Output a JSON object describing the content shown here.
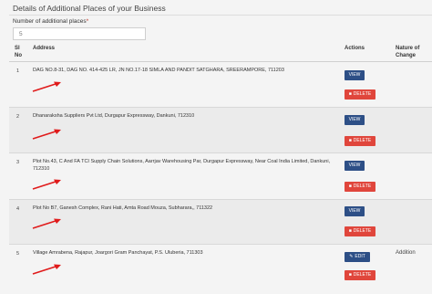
{
  "section": {
    "title": "Details of Additional Places of your Business",
    "field_label": "Number of additional places",
    "required_marker": "*",
    "field_value": "5"
  },
  "table": {
    "headers": {
      "sl_no_line1": "Sl",
      "sl_no_line2": "No",
      "address": "Address",
      "actions": "Actions",
      "nature_line1": "Nature of",
      "nature_line2": "Change"
    },
    "rows": [
      {
        "sl_no": "1",
        "address": "DAG NO.8-31, DAG NO. 414-425 LR, JN NO.17-18 SIMLA AND PANDIT SATGHARA, SREERAMPORE, 711203",
        "primary_action": "VIEW",
        "delete_action": "DELETE",
        "nature_of_change": ""
      },
      {
        "sl_no": "2",
        "address": "Dhanaraksha Suppliers Pvt Ltd, Durgapur Expressway, Dankuni, 712310",
        "primary_action": "VIEW",
        "delete_action": "DELETE",
        "nature_of_change": ""
      },
      {
        "sl_no": "3",
        "address": "Plot No.43, C And FA TCI Supply Chain Solutions, Aarrjav Warehousing Par, Durgapur Expressway, Near Coal India Limited, Dankuni, 712310",
        "primary_action": "VIEW",
        "delete_action": "DELETE",
        "nature_of_change": ""
      },
      {
        "sl_no": "4",
        "address": "Plot No B7, Ganesh Complex, Rani Hati, Amta Road Mouza, Subharara,, 711322",
        "primary_action": "VIEW",
        "delete_action": "DELETE",
        "nature_of_change": ""
      },
      {
        "sl_no": "5",
        "address": "Village Amrabena, Rajapur, Joargori Gram Panchayat, P.S. Uluberia, 711303",
        "primary_action": "EDIT",
        "delete_action": "DELETE",
        "nature_of_change": "Addition"
      }
    ]
  },
  "colors": {
    "primary_button": "#2d4f86",
    "delete_button": "#e0463c",
    "annotation_arrow": "#e01b1b"
  },
  "icons": {
    "delete": "trash-icon",
    "edit": "pencil-icon",
    "annotation": "red-arrow-annotation"
  }
}
